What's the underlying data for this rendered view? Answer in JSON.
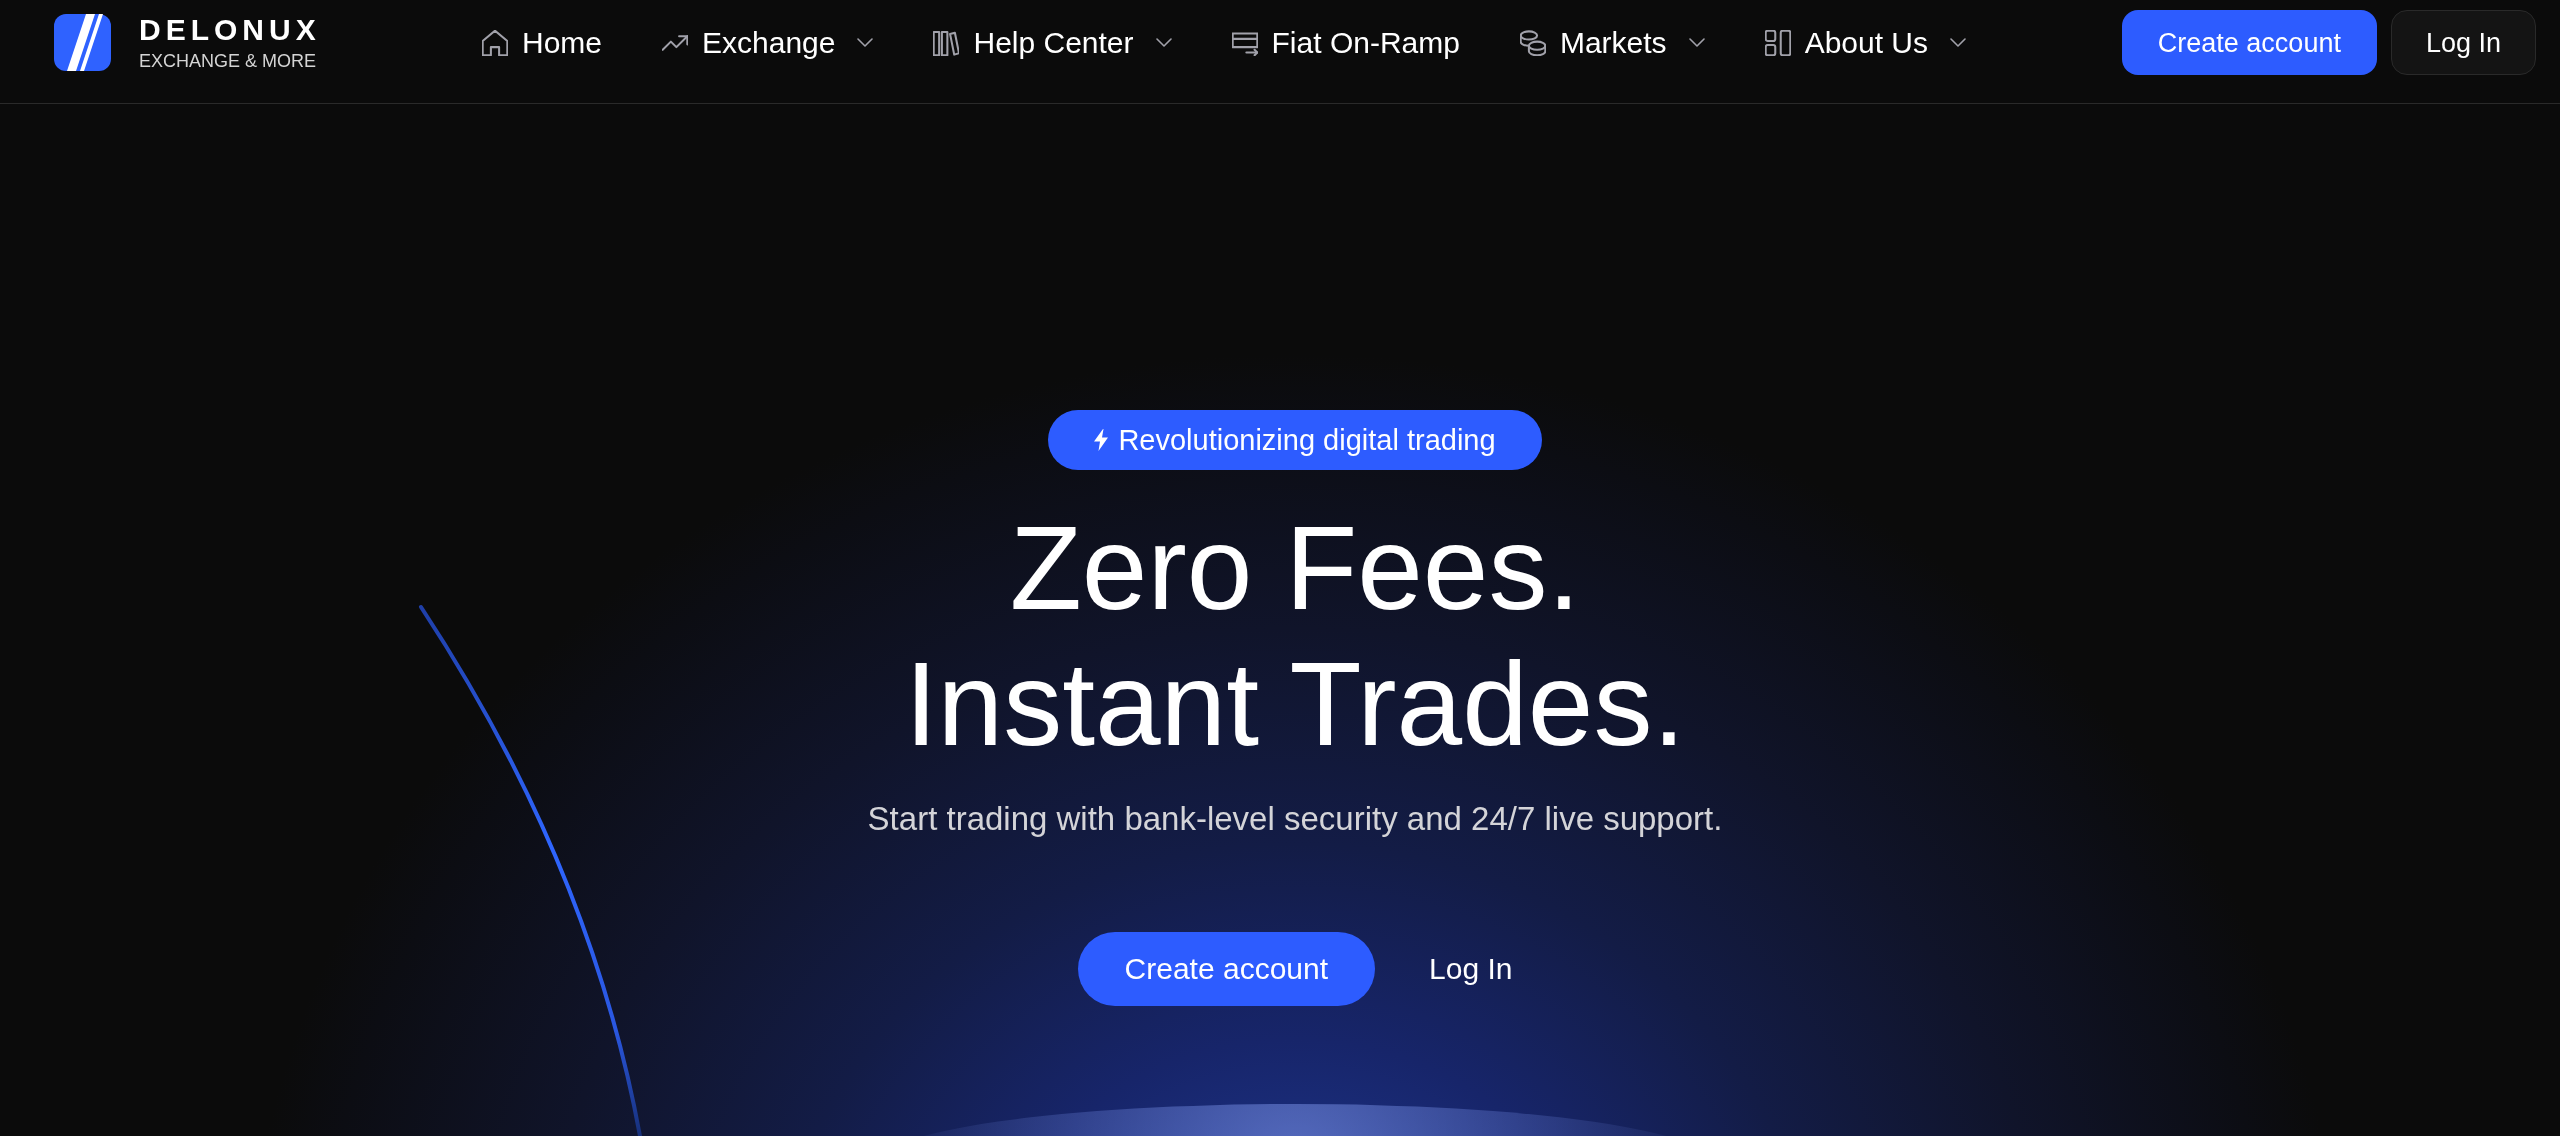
{
  "header": {
    "brand": {
      "name": "DELONUX",
      "tagline": "EXCHANGE & MORE"
    },
    "nav": [
      {
        "label": "Home",
        "has_menu": false
      },
      {
        "label": "Exchange",
        "has_menu": true
      },
      {
        "label": "Help Center",
        "has_menu": true
      },
      {
        "label": "Fiat On-Ramp",
        "has_menu": false
      },
      {
        "label": "Markets",
        "has_menu": true
      },
      {
        "label": "About Us",
        "has_menu": true
      }
    ],
    "actions": [
      {
        "label": "Create account",
        "kind": "primary"
      },
      {
        "label": "Log In",
        "kind": "secondary"
      }
    ]
  },
  "hero": {
    "badge": "Revolutionizing digital trading",
    "title_lines": [
      "Zero Fees.",
      "Instant Trades."
    ],
    "subtitle": "Start trading with bank-level security and 24/7 live support.",
    "buttons": [
      {
        "label": "Create account",
        "kind": "primary"
      },
      {
        "label": "Log In",
        "kind": "text"
      }
    ]
  }
}
